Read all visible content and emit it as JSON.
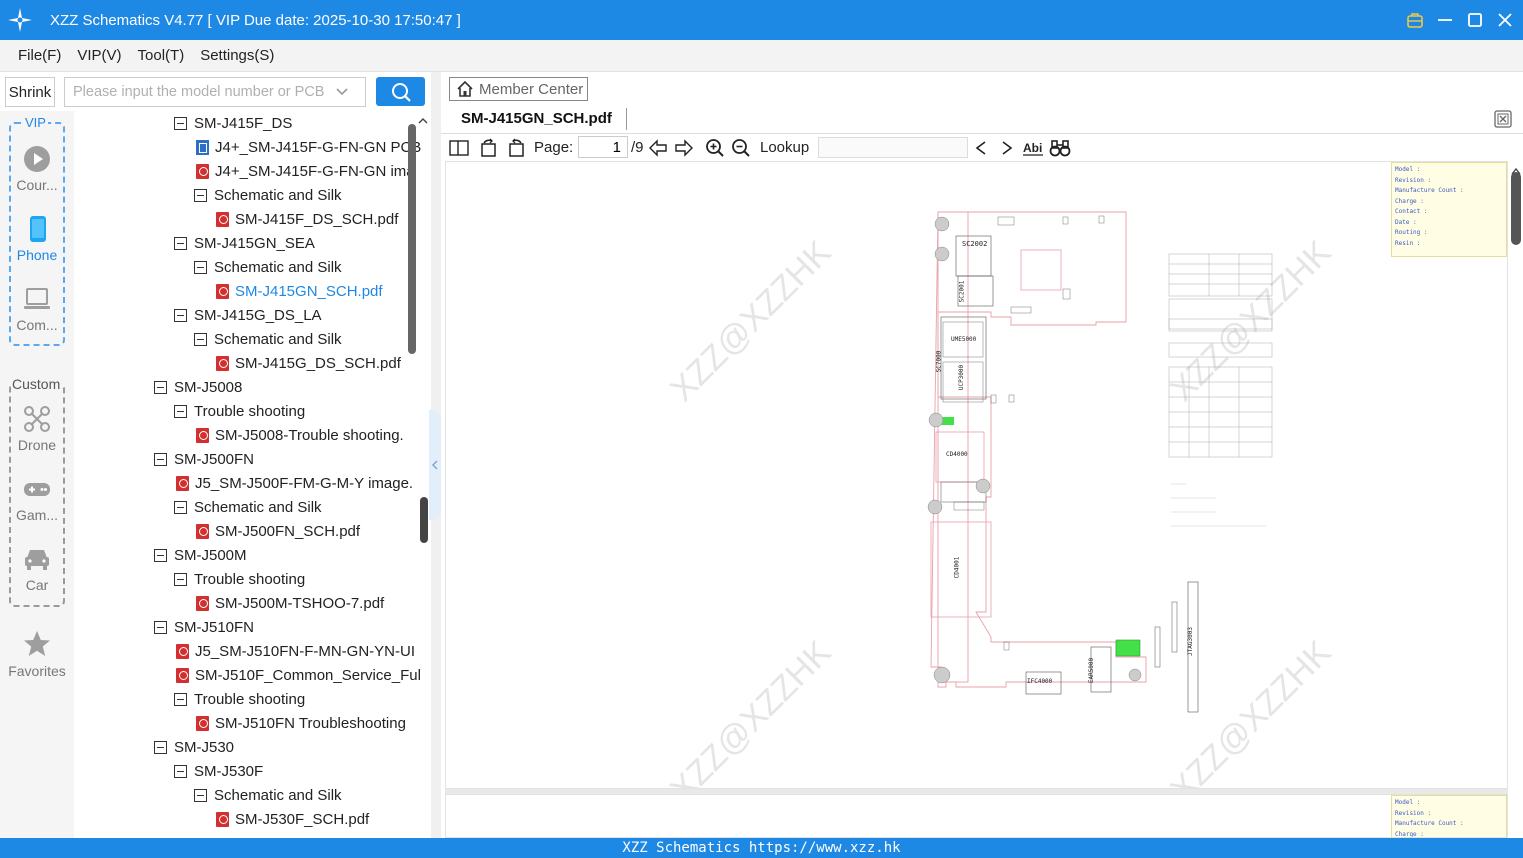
{
  "window": {
    "title": "XZZ Schematics V4.77 [ VIP Due date: 2025-10-30 17:50:47 ]"
  },
  "menu": [
    "File(F)",
    "VIP(V)",
    "Tool(T)",
    "Settings(S)"
  ],
  "search": {
    "shrink_label": "Shrink",
    "placeholder": "Please input the model number or PCB"
  },
  "rail": {
    "vip_label": "VIP",
    "custom_label": "Custom",
    "items": [
      "Cour...",
      "Phone",
      "Com...",
      "Drone",
      "Gam...",
      "Car",
      "Favorites"
    ]
  },
  "tree": [
    {
      "label": "SM-J415F_DS",
      "type": "folder",
      "level": 2
    },
    {
      "label": "J4+_SM-J415F-G-FN-GN PCB",
      "type": "pcb",
      "level": 3
    },
    {
      "label": "J4+_SM-J415F-G-FN-GN ima",
      "type": "pdf",
      "level": 3
    },
    {
      "label": "Schematic and Silk",
      "type": "folder",
      "level": 3
    },
    {
      "label": "SM-J415F_DS_SCH.pdf",
      "type": "pdf",
      "level": 4
    },
    {
      "label": "SM-J415GN_SEA",
      "type": "folder",
      "level": 2
    },
    {
      "label": "Schematic and Silk",
      "type": "folder",
      "level": 3
    },
    {
      "label": "SM-J415GN_SCH.pdf",
      "type": "pdf",
      "level": 4,
      "selected": true
    },
    {
      "label": "SM-J415G_DS_LA",
      "type": "folder",
      "level": 2
    },
    {
      "label": "Schematic and Silk",
      "type": "folder",
      "level": 3
    },
    {
      "label": "SM-J415G_DS_SCH.pdf",
      "type": "pdf",
      "level": 4
    },
    {
      "label": "SM-J5008",
      "type": "folder",
      "level": 1
    },
    {
      "label": "Trouble shooting",
      "type": "folder",
      "level": 2
    },
    {
      "label": "SM-J5008-Trouble shooting.",
      "type": "pdf",
      "level": 3
    },
    {
      "label": "SM-J500FN",
      "type": "folder",
      "level": 1
    },
    {
      "label": "J5_SM-J500F-FM-G-M-Y image.",
      "type": "pdf",
      "level": 2
    },
    {
      "label": "Schematic and Silk",
      "type": "folder",
      "level": 2
    },
    {
      "label": "SM-J500FN_SCH.pdf",
      "type": "pdf",
      "level": 3
    },
    {
      "label": "SM-J500M",
      "type": "folder",
      "level": 1
    },
    {
      "label": "Trouble shooting",
      "type": "folder",
      "level": 2
    },
    {
      "label": "SM-J500M-TSHOO-7.pdf",
      "type": "pdf",
      "level": 3
    },
    {
      "label": "SM-J510FN",
      "type": "folder",
      "level": 1
    },
    {
      "label": "J5_SM-J510FN-F-MN-GN-YN-UI",
      "type": "pdf",
      "level": 2
    },
    {
      "label": "SM-J510F_Common_Service_Ful",
      "type": "pdf",
      "level": 2
    },
    {
      "label": "Trouble shooting",
      "type": "folder",
      "level": 2
    },
    {
      "label": "SM-J510FN Troubleshooting",
      "type": "pdf",
      "level": 3
    },
    {
      "label": "SM-J530",
      "type": "folder",
      "level": 1
    },
    {
      "label": "SM-J530F",
      "type": "folder",
      "level": 2
    },
    {
      "label": "Schematic and Silk",
      "type": "folder",
      "level": 3
    },
    {
      "label": "SM-J530F_SCH.pdf",
      "type": "pdf",
      "level": 4
    }
  ],
  "member_center": "Member Center",
  "tab": {
    "label": "SM-J415GN_SCH.pdf"
  },
  "toolbar": {
    "page_label": "Page:",
    "page_value": "1",
    "page_total": "/9",
    "lookup_label": "Lookup"
  },
  "viewer": {
    "info_fields": [
      "Model :",
      "Revision :",
      "Manufacture Count :",
      "Charge :",
      "Contact :",
      "Date :",
      "Routing :",
      "Resin :"
    ],
    "info_fields_2": [
      "Model :",
      "Revision :",
      "Manufacture Count :",
      "Charge :"
    ],
    "watermark": "XZZ@XZZHK",
    "board_labels": [
      "SC2002",
      "SC2001",
      "UME5000",
      "SC7000",
      "UCP3000",
      "CD4000",
      "CD4001",
      "IFC4000",
      "EAR5000",
      "JTAG3003"
    ]
  },
  "status_bar": "XZZ Schematics https://www.xzz.hk",
  "colors": {
    "accent": "#1e88e5",
    "selected_text": "#1e88e5",
    "pdf_icon": "#d32f2f"
  }
}
